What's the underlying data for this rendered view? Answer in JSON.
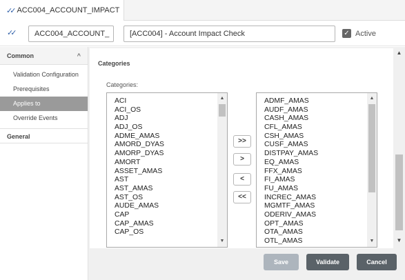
{
  "tab": {
    "label": "ACC004_ACCOUNT_IMPACT"
  },
  "header": {
    "code_value": "ACC004_ACCOUNT_",
    "description_value": "[ACC004] - Account Impact Check",
    "active_label": "Active",
    "active_checked": true
  },
  "sidebar": {
    "section_common": "Common",
    "items": [
      {
        "label": "Validation Configuration"
      },
      {
        "label": "Prerequisites"
      },
      {
        "label": "Applies to"
      },
      {
        "label": "Override Events"
      }
    ],
    "section_general": "General"
  },
  "categories": {
    "title": "Categories",
    "field_label": "Categories:",
    "available": [
      "ACI",
      "ACI_OS",
      "ADJ",
      "ADJ_OS",
      "ADME_AMAS",
      "AMORD_DYAS",
      "AMORP_DYAS",
      "AMORT",
      "ASSET_AMAS",
      "AST",
      "AST_AMAS",
      "AST_OS",
      "AUDE_AMAS",
      "CAP",
      "CAP_AMAS",
      "CAP_OS"
    ],
    "selected": [
      "ADMF_AMAS",
      "AUDF_AMAS",
      "CASH_AMAS",
      "CFL_AMAS",
      "CSH_AMAS",
      "CUSF_AMAS",
      "DISTPAY_AMAS",
      "EQ_AMAS",
      "FFX_AMAS",
      "FI_AMAS",
      "FU_AMAS",
      "INCREC_AMAS",
      "MGMTF_AMAS",
      "ODERIV_AMAS",
      "OPT_AMAS",
      "OTA_AMAS",
      "OTL_AMAS"
    ],
    "move_buttons": {
      "add_all": ">>",
      "add": ">",
      "remove": "<",
      "remove_all": "<<"
    }
  },
  "footer": {
    "save": "Save",
    "validate": "Validate",
    "cancel": "Cancel"
  }
}
